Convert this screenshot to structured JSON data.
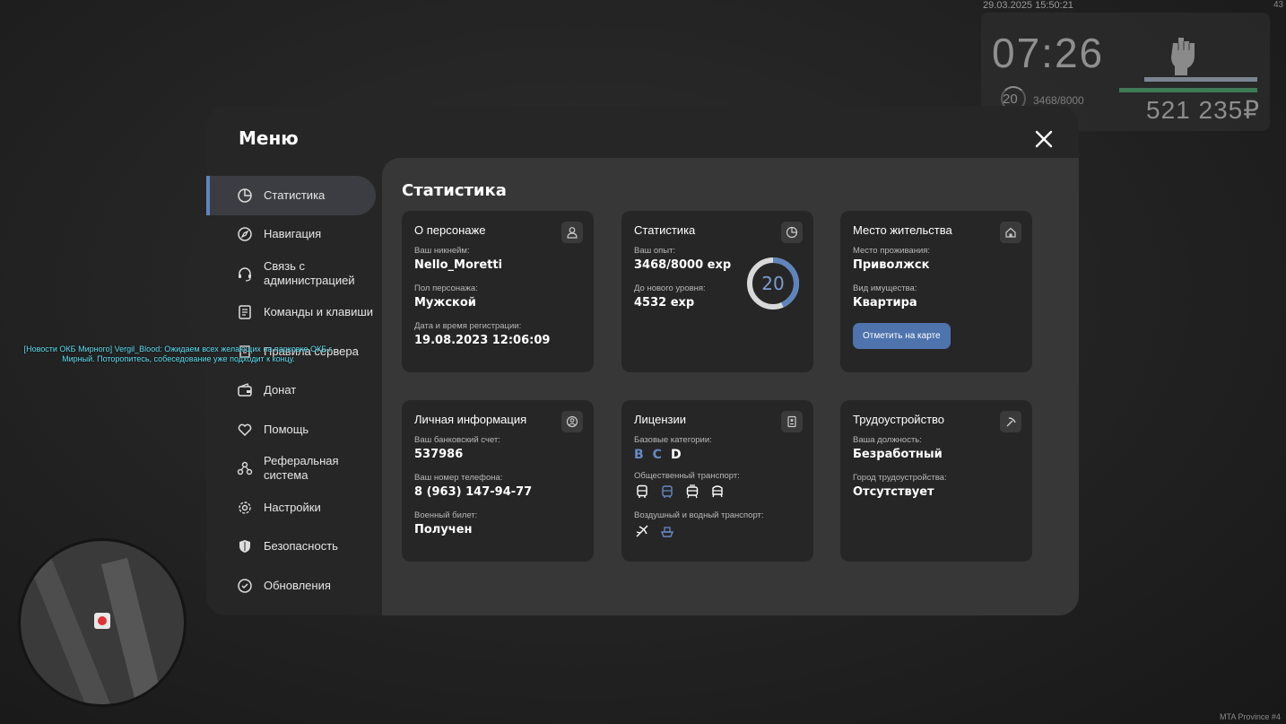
{
  "hud": {
    "datetime": "29.03.2025 15:50:21",
    "corner": "43",
    "clock": "07:26",
    "level": "20",
    "exp": "3468/8000",
    "money": "521 235₽",
    "server": "MTA Province #4"
  },
  "news": "[Новости ОКБ Мирного] Vergil_Blood: Ожидаем всех желающих на парковке ОКБ г. Мирный. Поторопитесь, собеседование уже подходит к концу.",
  "menu": {
    "title": "Меню",
    "close_icon": "close-icon",
    "items": [
      {
        "label": "Статистика",
        "icon": "statistics-icon",
        "active": true
      },
      {
        "label": "Навигация",
        "icon": "compass-icon"
      },
      {
        "label": "Связь с администрацией",
        "icon": "headset-icon"
      },
      {
        "label": "Команды и клавиши",
        "icon": "document-icon"
      },
      {
        "label": "Правила сервера",
        "icon": "rules-icon"
      },
      {
        "label": "Донат",
        "icon": "wallet-icon"
      },
      {
        "label": "Помощь",
        "icon": "help-heart-icon"
      },
      {
        "label": "Реферальная система",
        "icon": "referral-icon"
      },
      {
        "label": "Настройки",
        "icon": "gear-icon"
      },
      {
        "label": "Безопасность",
        "icon": "shield-icon"
      },
      {
        "label": "Обновления",
        "icon": "update-icon"
      }
    ]
  },
  "content": {
    "title": "Статистика",
    "character": {
      "title": "О персонаже",
      "nick_label": "Ваш никнейм:",
      "nick": "Nello_Moretti",
      "gender_label": "Пол персонажа:",
      "gender": "Мужской",
      "reg_label": "Дата и время регистрации:",
      "reg": "19.08.2023 12:06:09"
    },
    "stats": {
      "title": "Статистика",
      "exp_label": "Ваш опыт:",
      "exp": "3468/8000 exp",
      "next_label": "До нового уровня:",
      "next": "4532 exp",
      "level": "20",
      "progress": 0.4335
    },
    "residence": {
      "title": "Место жительства",
      "place_label": "Место проживания:",
      "place": "Приволжск",
      "type_label": "Вид имущества:",
      "type": "Квартира",
      "button": "Отметить на карте"
    },
    "personal": {
      "title": "Личная информация",
      "bank_label": "Ваш банковский счет:",
      "bank": "537986",
      "phone_label": "Ваш номер телефона:",
      "phone": "8 (963) 147-94-77",
      "military_label": "Военный билет:",
      "military": "Получен"
    },
    "licenses": {
      "title": "Лицензии",
      "basic_label": "Базовые категории:",
      "categories": [
        {
          "name": "B",
          "owned": true
        },
        {
          "name": "C",
          "owned": true
        },
        {
          "name": "D",
          "owned": false
        }
      ],
      "public_label": "Общественный транспорт:",
      "public_icons": [
        "bus-icon",
        "trolleybus-icon",
        "tram-icon",
        "train-icon"
      ],
      "air_label": "Воздушный и водный транспорт:",
      "air_icons": [
        "plane-icon",
        "boat-icon"
      ]
    },
    "employment": {
      "title": "Трудоустройство",
      "position_label": "Ваша должность:",
      "position": "Безработный",
      "city_label": "Город трудоустройства:",
      "city": "Отсутствует"
    }
  },
  "colors": {
    "accent": "#5e84be",
    "button": "#4e73ad",
    "ring": "#7d9cd0",
    "window": "#262626",
    "panel": "#373737",
    "news": "#5fe0f2"
  }
}
